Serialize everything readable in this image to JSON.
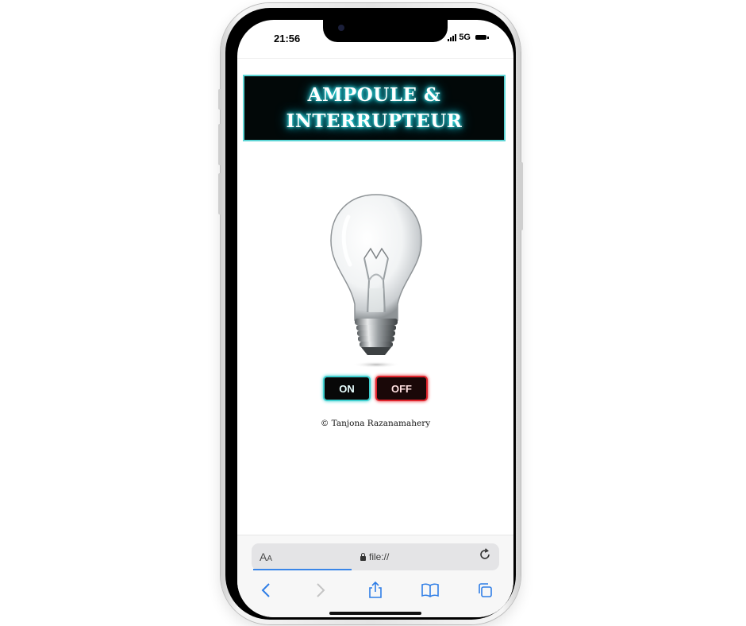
{
  "status_bar": {
    "time": "21:56",
    "network": "5G"
  },
  "app": {
    "title": "AMPOULE &\nINTERRUPTEUR",
    "buttons": {
      "on_label": "ON",
      "off_label": "OFF"
    },
    "credit": "© Tanjona Razanamahery"
  },
  "browser": {
    "text_size_label_big": "A",
    "text_size_label_small": "A",
    "url": "file://",
    "icons": [
      "back-icon",
      "forward-icon",
      "share-icon",
      "bookmarks-icon",
      "tabs-icon",
      "reload-icon",
      "lock-icon"
    ]
  },
  "colors": {
    "title_glow": "#3ff4f4",
    "on_border": "#3fd0d0",
    "off_border": "#e0242c",
    "url_progress": "#3a86e8"
  }
}
